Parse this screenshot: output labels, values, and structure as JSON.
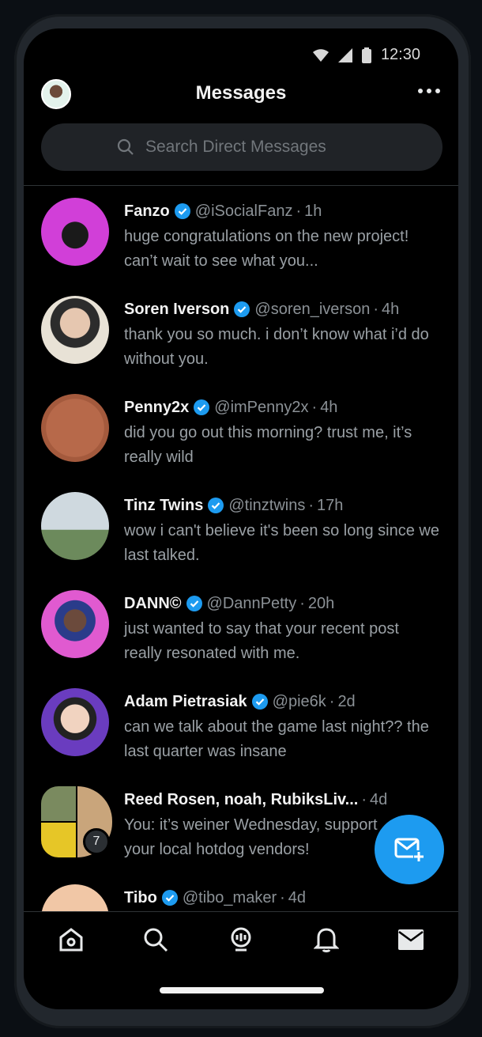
{
  "status_bar": {
    "time": "12:30"
  },
  "header": {
    "title": "Messages"
  },
  "search": {
    "placeholder": "Search Direct Messages"
  },
  "conversations": [
    {
      "name": "Fanzo",
      "handle": "@iSocialFanz",
      "time": "1h",
      "verified": true,
      "preview": "huge congratulations on the new project! can’t wait to see what you..."
    },
    {
      "name": "Soren Iverson",
      "handle": "@soren_iverson",
      "time": "4h",
      "verified": true,
      "preview": "thank you so much. i don’t know what i’d do without you."
    },
    {
      "name": "Penny2x",
      "handle": "@imPenny2x",
      "time": "4h",
      "verified": true,
      "preview": "did you go out this morning? trust me, it’s really wild"
    },
    {
      "name": "Tinz Twins",
      "handle": "@tinztwins",
      "time": "17h",
      "verified": true,
      "preview": "wow i can't believe it's been so long since we last talked."
    },
    {
      "name": "DANN©",
      "handle": "@DannPetty",
      "time": "20h",
      "verified": true,
      "preview": "just wanted to say that your recent post really resonated with me."
    },
    {
      "name": "Adam Pietrasiak",
      "handle": "@pie6k",
      "time": "2d",
      "verified": true,
      "preview": "can we talk about the game last night?? the last quarter was insane"
    },
    {
      "name": "Reed Rosen, noah, RubiksLiv...",
      "handle": "",
      "time": "4d",
      "verified": false,
      "group_count": "7",
      "preview": "You: it’s weiner Wednesday, support your local hotdog vendors!"
    },
    {
      "name": "Tibo",
      "handle": "@tibo_maker",
      "time": "4d",
      "verified": true,
      "preview": ""
    }
  ],
  "icons": {
    "more": "more-horizontal-icon",
    "search": "search-icon",
    "verified": "verified-badge-icon",
    "fab": "new-message-icon",
    "nav": [
      "home-icon",
      "search-icon",
      "spaces-icon",
      "bell-icon",
      "mail-icon"
    ]
  },
  "colors": {
    "accent": "#1d9bf0",
    "background": "#000000"
  }
}
